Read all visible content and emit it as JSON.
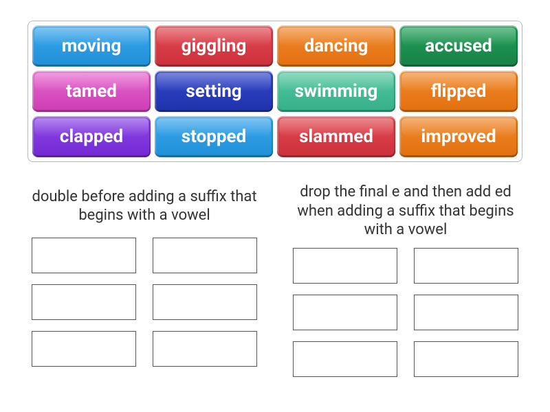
{
  "tiles": [
    {
      "label": "moving",
      "color": "blue"
    },
    {
      "label": "giggling",
      "color": "red"
    },
    {
      "label": "dancing",
      "color": "orange"
    },
    {
      "label": "accused",
      "color": "green"
    },
    {
      "label": "tamed",
      "color": "pink"
    },
    {
      "label": "setting",
      "color": "navy"
    },
    {
      "label": "swimming",
      "color": "teal"
    },
    {
      "label": "flipped",
      "color": "orange"
    },
    {
      "label": "clapped",
      "color": "purple"
    },
    {
      "label": "stopped",
      "color": "blue"
    },
    {
      "label": "slammed",
      "color": "red"
    },
    {
      "label": "improved",
      "color": "orange"
    }
  ],
  "groups": [
    {
      "title": "double before adding a suffix that begins with a vowel",
      "slot_count": 6
    },
    {
      "title": "drop the final e and then add ed when adding a suffix that begins with a vowel",
      "slot_count": 6
    }
  ]
}
